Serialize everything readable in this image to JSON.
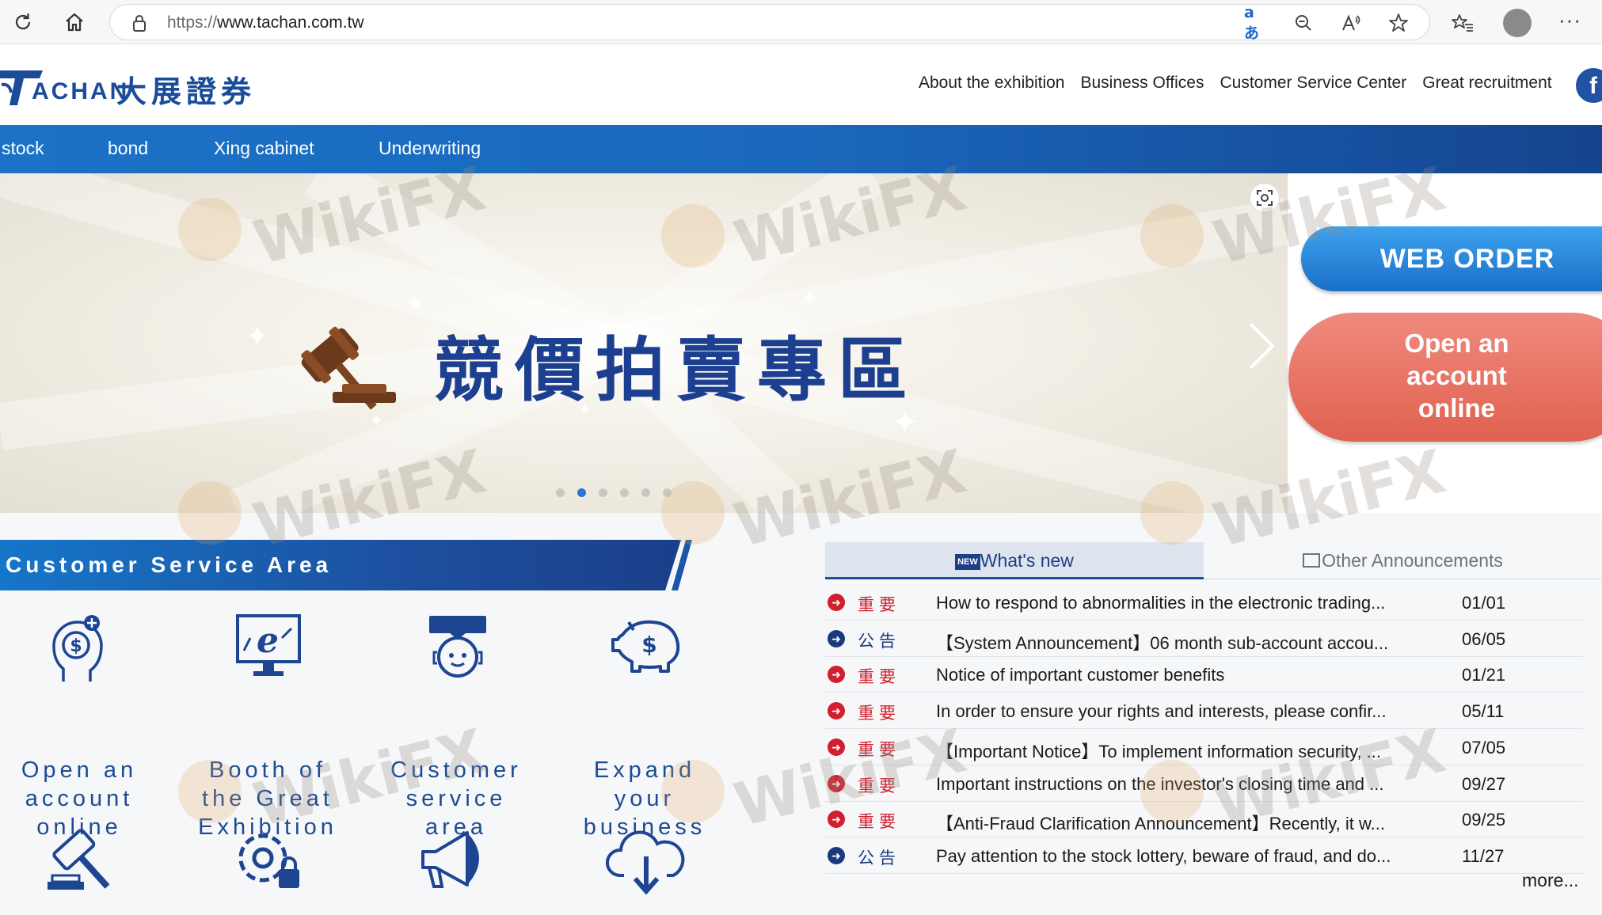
{
  "browser": {
    "url_protocol": "https://",
    "url_host": "www.tachan.com.tw",
    "translate_glyph": "aあ",
    "menu_glyph": "···"
  },
  "header": {
    "logo_word": "ACHAN",
    "logo_cn": "大展證券",
    "links": [
      "About the exhibition",
      "Business Offices",
      "Customer Service Center",
      "Great recruitment"
    ],
    "fb_glyph": "f"
  },
  "nav": {
    "items": [
      "stock",
      "bond",
      "Xing cabinet",
      "Underwriting"
    ]
  },
  "banner": {
    "title": "競價拍賣專區",
    "slide_count": 6,
    "active_slide": 2
  },
  "side": {
    "web_order": "WEB ORDER",
    "open_account": [
      "Open an",
      "account",
      "online"
    ]
  },
  "service": {
    "title": "Customer Service Area",
    "items": [
      {
        "lines": [
          "Open an",
          "account",
          "online"
        ]
      },
      {
        "lines": [
          "Booth of",
          "the Great",
          "Exhibition"
        ]
      },
      {
        "lines": [
          "Customer",
          "service",
          "area"
        ]
      },
      {
        "lines": [
          "Expand",
          "your",
          "business"
        ]
      }
    ]
  },
  "news": {
    "tab_new": "What's new",
    "tab_new_badge": "NEW",
    "tab_other": "Other Announcements",
    "rows": [
      {
        "tag": "重要",
        "type": "important",
        "text": "How to respond to abnormalities in the electronic trading...",
        "date": "01/01"
      },
      {
        "tag": "公告",
        "type": "notice",
        "text": "【System Announcement】06 month sub-account accou...",
        "date": "06/05"
      },
      {
        "tag": "重要",
        "type": "important",
        "text": "Notice of important customer benefits",
        "date": "01/21"
      },
      {
        "tag": "重要",
        "type": "important",
        "text": "In order to ensure your rights and interests, please confir...",
        "date": "05/11"
      },
      {
        "tag": "重要",
        "type": "important",
        "text": "【Important Notice】To implement information security, ...",
        "date": "07/05"
      },
      {
        "tag": "重要",
        "type": "important",
        "text": "Important instructions on the investor's closing time and ...",
        "date": "09/27"
      },
      {
        "tag": "重要",
        "type": "important",
        "text": "【Anti-Fraud Clarification Announcement】Recently, it w...",
        "date": "09/25"
      },
      {
        "tag": "公告",
        "type": "notice",
        "text": "Pay attention to the stock lottery, beware of fraud, and do...",
        "date": "11/27"
      }
    ],
    "more": "more..."
  },
  "watermark": "WikiFX",
  "colors": {
    "brand_blue": "#1b4c9a",
    "important_red": "#d21f2f",
    "notice_blue": "#1b3a7e"
  }
}
